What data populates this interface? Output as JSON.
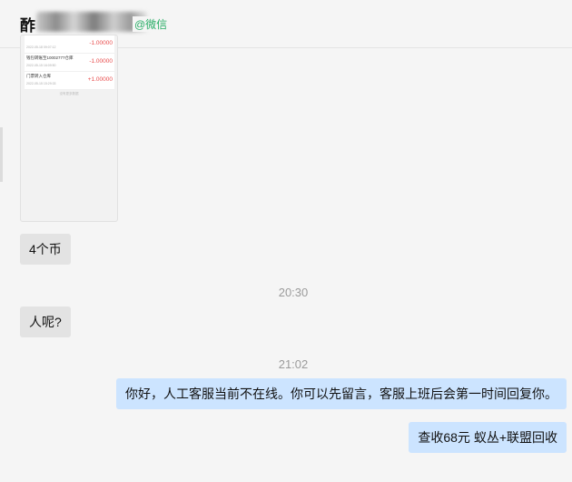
{
  "header": {
    "title": "酢",
    "wechat_tag": "@微信"
  },
  "image_message": {
    "records": [
      {
        "name": "",
        "time": "2022-05-18 09:07:12",
        "amount": "-1.00000"
      },
      {
        "name": "钱包转账至10002777仓库",
        "time": "2022-05-15 16:09:50",
        "amount": "-1.00000"
      },
      {
        "name": "门票转入仓库",
        "time": "2022-05-15 15:29:33",
        "amount": "+1.00000"
      }
    ],
    "end_note": "没有更多数据"
  },
  "messages": {
    "m1": "4个币",
    "t1": "20:30",
    "m2": "人呢?",
    "t2": "21:02",
    "m3": "你好，人工客服当前不在线。你可以先留言，客服上班后会第一时间回复你。",
    "m4": "查收68元  蚁丛+联盟回收"
  },
  "colors": {
    "incoming_bubble": "#e3e3e3",
    "outgoing_bubble": "#cce4ff",
    "wechat_green": "#2aae67",
    "amount_red": "#e84c4c"
  }
}
